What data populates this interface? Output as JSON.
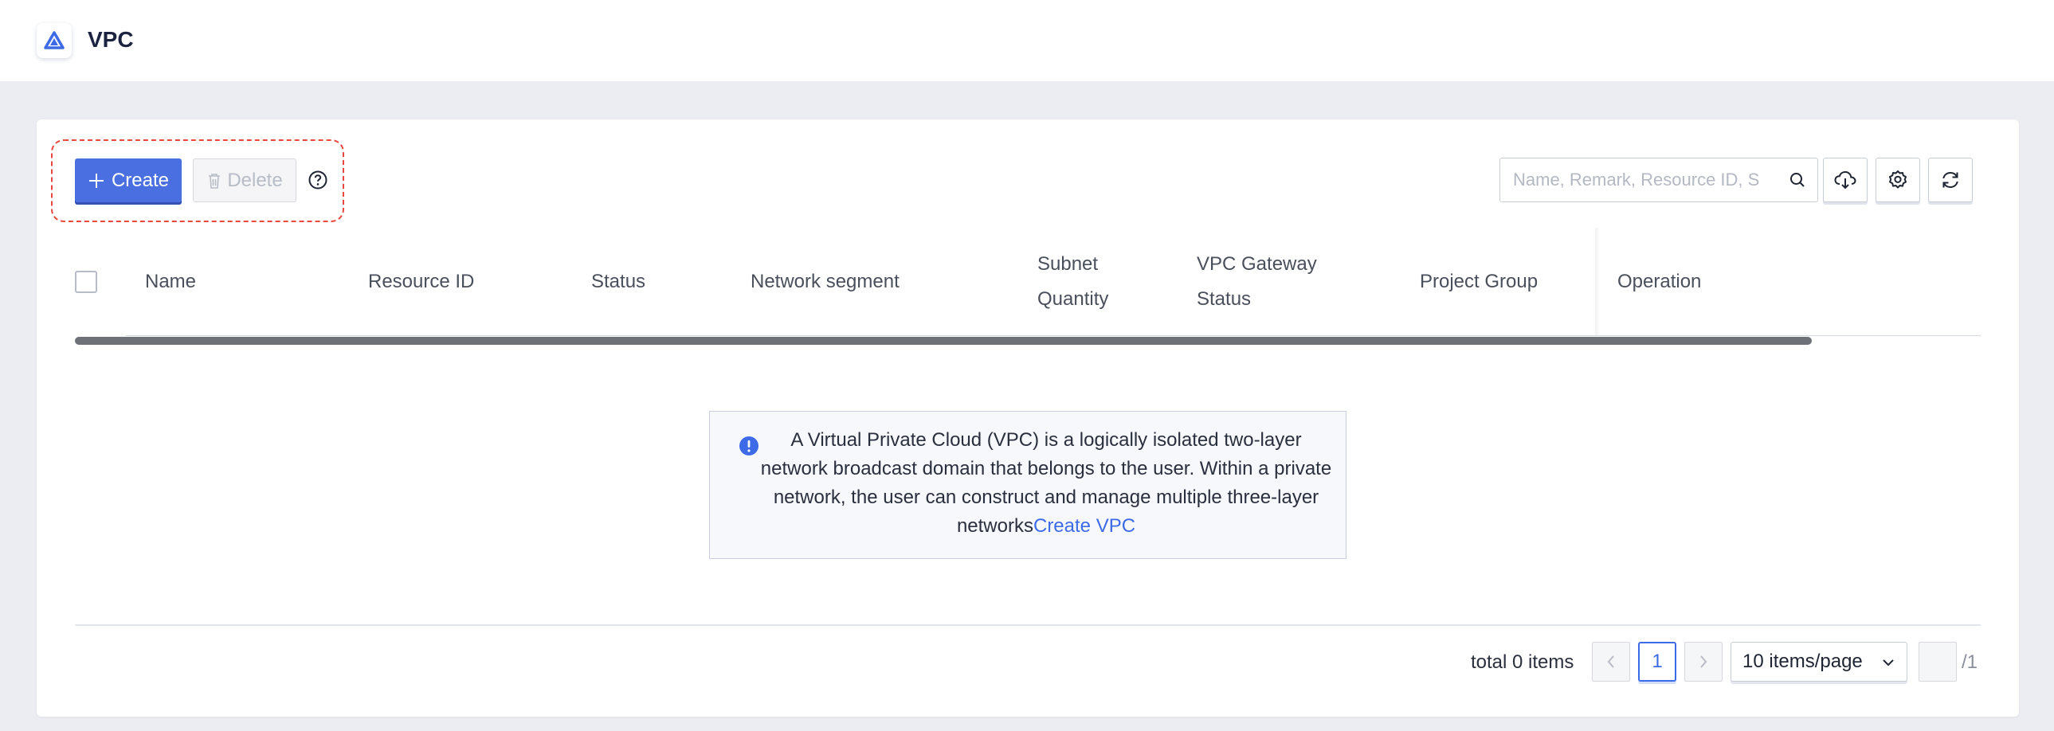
{
  "header": {
    "title": "VPC",
    "logo_icon": "vpc-logo-icon"
  },
  "toolbar": {
    "create_label": "Create",
    "delete_label": "Delete",
    "help_icon": "question-circle-icon",
    "search_placeholder": "Name, Remark, Resource ID, S",
    "download_icon": "cloud-download-icon",
    "settings_icon": "gear-icon",
    "refresh_icon": "refresh-icon"
  },
  "table": {
    "columns": {
      "name": "Name",
      "resource_id": "Resource ID",
      "status": "Status",
      "network_segment": "Network segment",
      "subnet_quantity_1": "Subnet",
      "subnet_quantity_2": "Quantity",
      "vpc_gateway_status_1": "VPC Gateway",
      "vpc_gateway_status_2": "Status",
      "project_group": "Project Group",
      "operation": "Operation"
    },
    "rows": []
  },
  "empty_notice": {
    "text": "A Virtual Private Cloud (VPC) is a logically isolated two-layer network broadcast domain that belongs to the user. Within a private network, the user can construct and manage multiple three-layer networks",
    "link": "Create VPC"
  },
  "pagination": {
    "total": "total 0 items",
    "current_page": "1",
    "page_size": "10 items/page",
    "jump_value": "",
    "total_pages": "/1"
  },
  "colors": {
    "accent": "#4a6fe0",
    "link": "#3d6ae6",
    "highlight_dashed": "#e8483d",
    "background": "#ecedf3"
  }
}
